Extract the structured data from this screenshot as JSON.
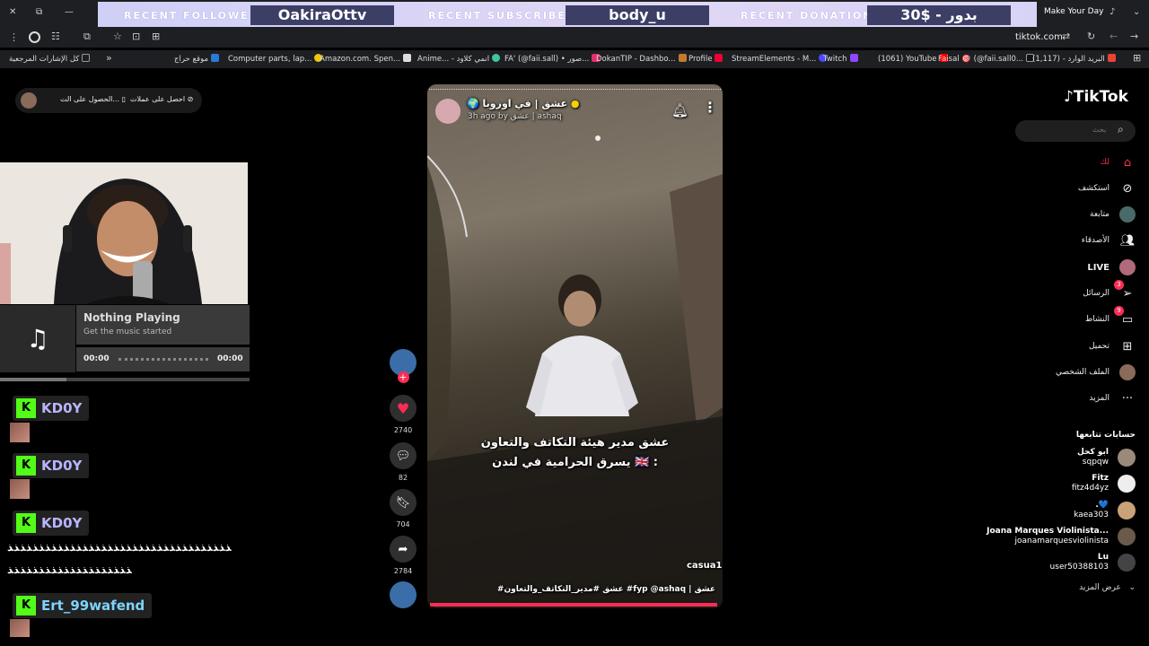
{
  "overlay": {
    "follower_label": "RECENT FOLLOWER",
    "follower_value": "OakiraOttv",
    "subscriber_label": "RECENT SUBSCRIBER",
    "subscriber_value": "body_u",
    "donation_label": "RECENT DONATION",
    "donation_value": "30$ - بدور"
  },
  "browser": {
    "notification_title": "Make Your Day",
    "address": "tiktok.com"
  },
  "bookmarks": [
    {
      "label": "كل الإشارات المرجعية",
      "color": "#999"
    },
    {
      "label": "موقع حراج",
      "color": "#2a7bd8"
    },
    {
      "label": "Computer parts, lap...",
      "color": "#f1c40f"
    },
    {
      "label": "Amazon.com. Spen...",
      "color": "#ddd"
    },
    {
      "label": "Anime... - انمي كلاود",
      "color": "#3bc7a0"
    },
    {
      "label": "FA' (@faii.sall) • صور...",
      "color": "#e1306c"
    },
    {
      "label": "DokanTIP - Dashbo...",
      "color": "#c47a2c"
    },
    {
      "label": "Profile",
      "color": "#e03"
    },
    {
      "label": "StreamElements - M...",
      "color": "#4a4aff"
    },
    {
      "label": "Twitch",
      "color": "#9146ff"
    },
    {
      "label": "(1061) YouTube",
      "color": "#f00"
    },
    {
      "label": "Faisal 🎯 (@faii.sall0...",
      "color": "#111"
    },
    {
      "label": "البريد الوارد - (1,117)",
      "color": "#ea4335"
    }
  ],
  "stream": {
    "pill_item1": "احصل على عملات",
    "pill_item2": "الحصول على الت...",
    "music_icon": "music-note-icon",
    "now_playing_title": "Nothing Playing",
    "now_playing_subtitle": "Get the music started",
    "time_start": "00:00",
    "time_end": "00:00",
    "chat": [
      {
        "name": "KD0Y"
      },
      {
        "name": "KD0Y"
      },
      {
        "name": "KD0Y",
        "message": "ﺬﺬﺬﺬﺬﺬﺬﺬﺬﺬﺬﺬﺬﺬﺬﺬﺬﺬﺬﺬﺬﺬﺬﺬﺬﺬﺬﺬﺬﺬﺬﺬﺬﺬﺬﺬ",
        "message2": "ﺬﺬﺬﺬﺬﺬﺬﺬﺬﺬﺬﺬﺬﺬﺬﺬﺬﺬﺬﺬ"
      },
      {
        "name": "Ert_99wafend"
      }
    ]
  },
  "video": {
    "author_name": "عشق | في اوروبا 🌍",
    "meta": "3h ago by عشق | ashaq",
    "caption_line1": "عشق مدير هيئة التكاتف والتعاون",
    "caption_line2": "يسرق الحرامية في لندن 🇬🇧 :",
    "watermark": "casua1",
    "hashtags": "#عشق #مدير_التكاتف_والتعاون #fyp @ashaq | عشق"
  },
  "actions": {
    "likes": "2740",
    "comments": "82",
    "bookmarks": "704",
    "shares": "2784"
  },
  "tiktok": {
    "logo": "TikTok",
    "search_placeholder": "بحث",
    "nav": [
      {
        "label": "لك",
        "icon": "home-icon"
      },
      {
        "label": "استكشف",
        "icon": "compass-icon"
      },
      {
        "label": "متابعة",
        "icon": "following-icon"
      },
      {
        "label": "الأصدقاء",
        "icon": "friends-icon"
      },
      {
        "label": "LIVE",
        "icon": "live-icon"
      },
      {
        "label": "الرسائل",
        "icon": "messages-icon",
        "badge": "3"
      },
      {
        "label": "النشاط",
        "icon": "activity-icon",
        "badge": "9"
      },
      {
        "label": "تحميل",
        "icon": "upload-icon"
      },
      {
        "label": "الملف الشخصي",
        "icon": "profile-icon"
      },
      {
        "label": "المزيد",
        "icon": "more-icon"
      }
    ],
    "following_header": "حسابات تتابعها",
    "following": [
      {
        "name": "ابو كحل",
        "handle": "sqpqw"
      },
      {
        "name": "Fitz",
        "handle": "fitz4d4yz"
      },
      {
        "name": ".💙",
        "handle": "kaea303"
      },
      {
        "name": "Joana Marques Violinista...",
        "handle": "joanamarquesviolinista"
      },
      {
        "name": "Lu",
        "handle": "user50388103"
      }
    ],
    "see_more": "عرض المزيد"
  }
}
